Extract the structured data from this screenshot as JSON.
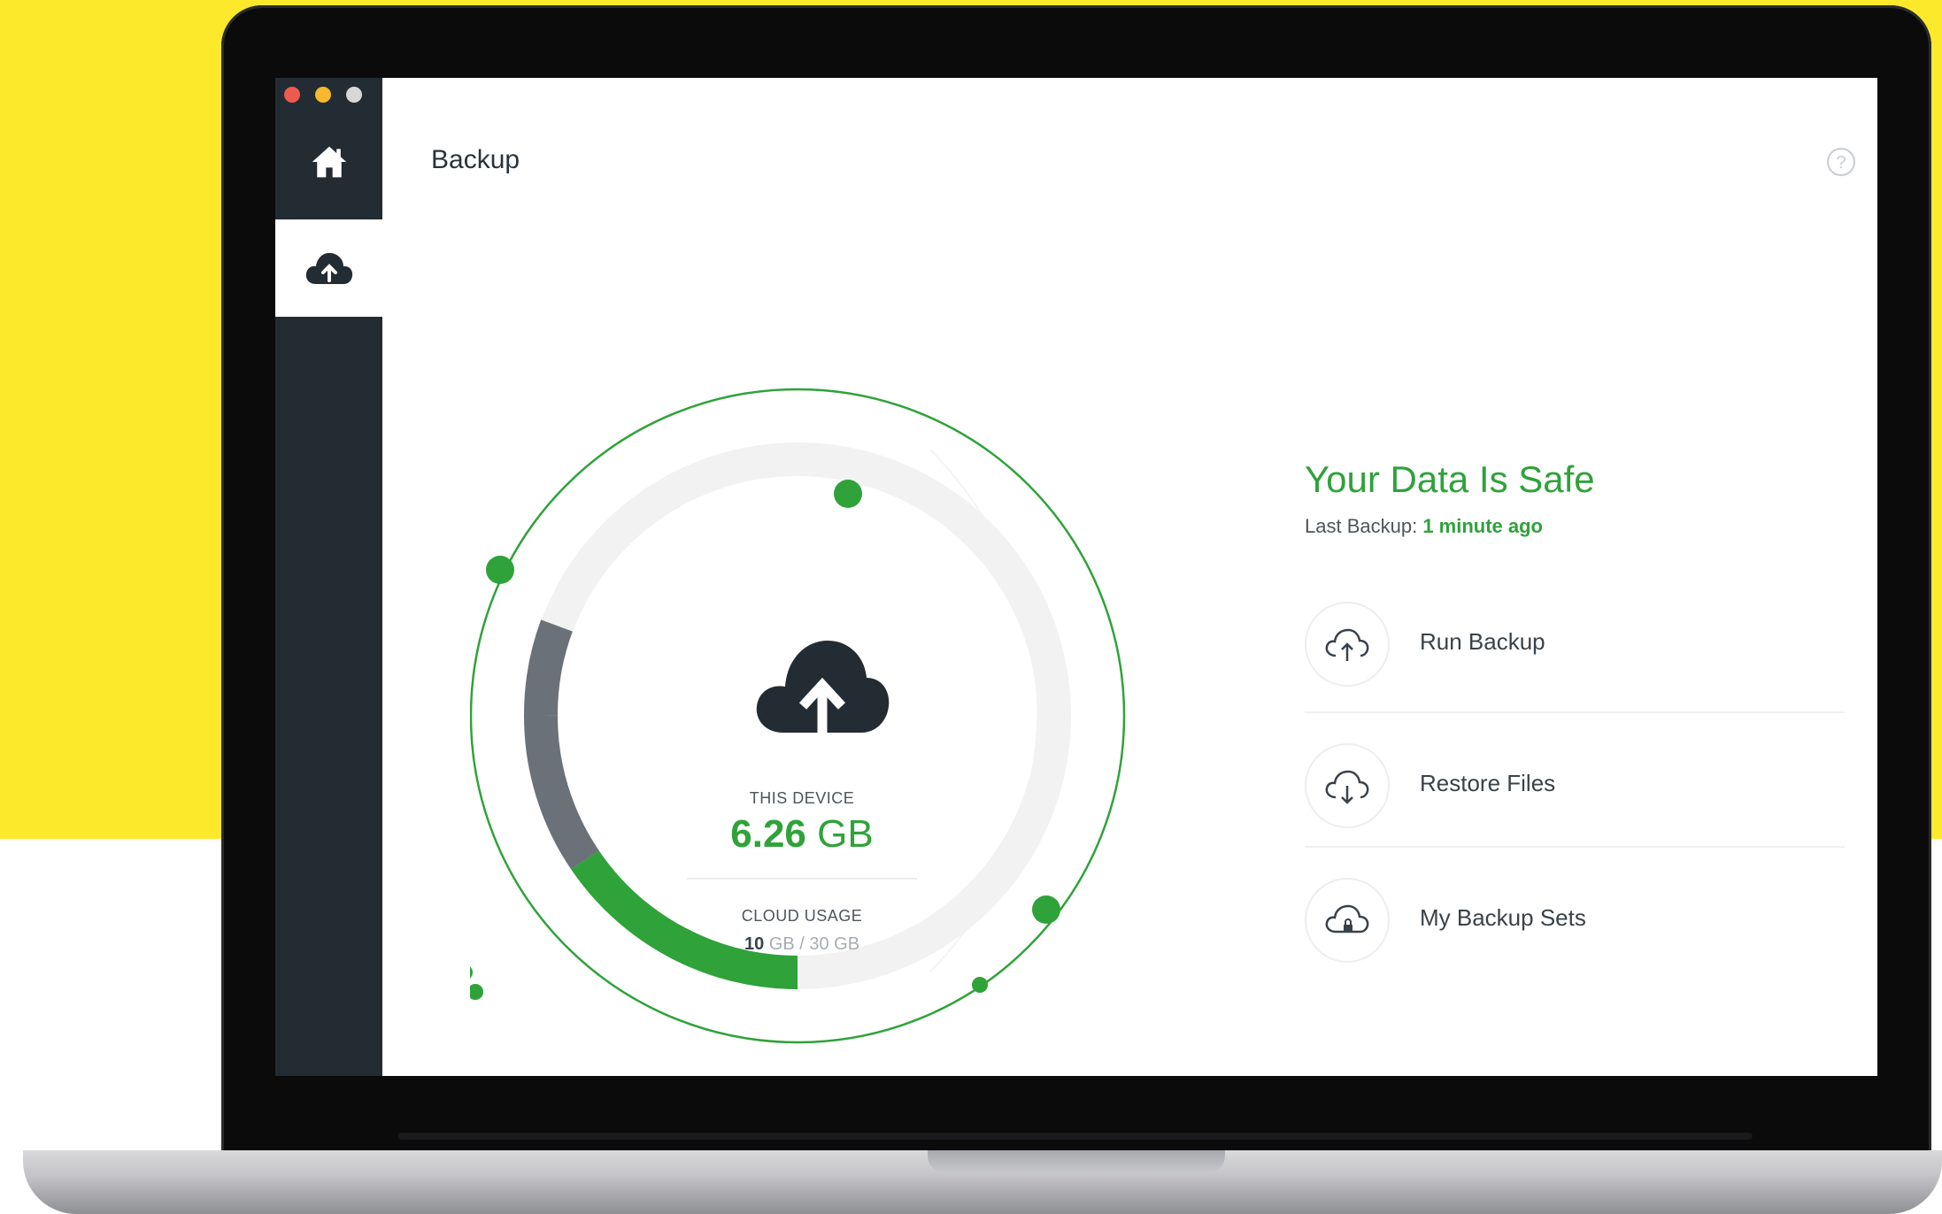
{
  "window": {
    "title": "Backup",
    "traffic_lights": [
      "#ee5a4e",
      "#f5b82e",
      "#d7d7d7"
    ]
  },
  "sidebar": {
    "items": [
      {
        "icon": "home-icon",
        "active": false
      },
      {
        "icon": "cloud-upload-icon",
        "active": true
      }
    ]
  },
  "gauge": {
    "device_label": "THIS DEVICE",
    "device_value": "6.26",
    "device_unit": "GB",
    "cloud_label": "CLOUD USAGE",
    "cloud_used": "10",
    "cloud_rest": "GB / 30 GB",
    "usage_fraction": 0.333
  },
  "status": {
    "title": "Your Data Is Safe",
    "last_backup_label": "Last Backup:",
    "last_backup_value": "1 minute ago"
  },
  "actions": [
    {
      "label": "Run Backup",
      "icon": "cloud-upload-icon"
    },
    {
      "label": "Restore Files",
      "icon": "cloud-download-icon"
    },
    {
      "label": "My Backup Sets",
      "icon": "cloud-lock-icon"
    }
  ],
  "colors": {
    "accent": "#2fa23a",
    "sidebar": "#232b33",
    "background": "#FDE92C"
  }
}
